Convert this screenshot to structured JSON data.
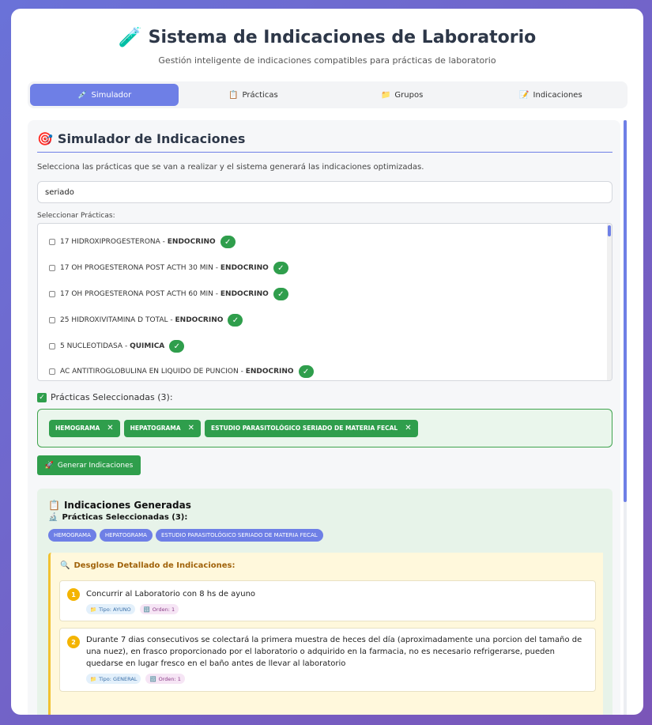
{
  "header": {
    "icon": "test-tube-icon",
    "title": "Sistema de Indicaciones de Laboratorio",
    "subtitle": "Gestión inteligente de indicaciones compatibles para prácticas de laboratorio"
  },
  "tabs": [
    {
      "label": "Simulador",
      "icon": "syringe-icon",
      "active": true
    },
    {
      "label": "Prácticas",
      "icon": "clipboard-icon",
      "active": false
    },
    {
      "label": "Grupos",
      "icon": "folder-icon",
      "active": false
    },
    {
      "label": "Indicaciones",
      "icon": "memo-icon",
      "active": false
    }
  ],
  "simulator": {
    "title": "Simulador de Indicaciones",
    "description": "Selecciona las prácticas que se van a realizar y el sistema generará las indicaciones optimizadas.",
    "search_value": "seriado",
    "select_label": "Seleccionar Prácticas:",
    "practices": [
      {
        "name": "17 HIDROXIPROGESTERONA",
        "sep": " - ",
        "area": "ENDOCRINO"
      },
      {
        "name": "17 OH PROGESTERONA POST ACTH 30 MIN",
        "sep": " - ",
        "area": "ENDOCRINO"
      },
      {
        "name": "17 OH PROGESTERONA POST ACTH 60 MIN",
        "sep": " - ",
        "area": "ENDOCRINO"
      },
      {
        "name": "25 HIDROXIVITAMINA D TOTAL",
        "sep": " - ",
        "area": "ENDOCRINO"
      },
      {
        "name": "5 NUCLEOTIDASA",
        "sep": " - ",
        "area": "QUIMICA"
      },
      {
        "name": "AC ANTITIROGLOBULINA EN LIQUIDO DE PUNCION",
        "sep": " - ",
        "area": "ENDOCRINO"
      }
    ],
    "check_glyph": "✓",
    "selected_title": "Prácticas Seleccionadas (3):",
    "selected_chips": [
      "HEMOGRAMA",
      "HEPATOGRAMA",
      "ESTUDIO PARASITOLÓGICO SERIADO DE MATERIA FECAL"
    ],
    "remove_glyph": "✕",
    "generate_label": "Generar Indicaciones"
  },
  "generated": {
    "title": "Indicaciones Generadas",
    "selected_title": "Prácticas Seleccionadas (3):",
    "pills": [
      "HEMOGRAMA",
      "HEPATOGRAMA",
      "ESTUDIO PARASITOLÓGICO SERIADO DE MATERIA FECAL"
    ],
    "breakdown_title": "Desglose Detallado de Indicaciones:",
    "indications": [
      {
        "num": "1",
        "text": "Concurrir al Laboratorio con 8 hs de ayuno",
        "tipo": "Tipo: AYUNO",
        "orden": "Orden: 1"
      },
      {
        "num": "2",
        "text": "Durante 7 dias consecutivos se colectará la primera muestra de heces del día (aproximadamente una porcion del tamaño de una nuez), en frasco proporcionado por el laboratorio o adquirido en la farmacia, no es necesario refrigerarse, pueden quedarse en lugar fresco en el baño antes de llevar al laboratorio",
        "tipo": "Tipo: GENERAL",
        "orden": "Orden: 1"
      }
    ]
  },
  "colors": {
    "accent": "#6e7fe6",
    "success": "#2f9e4c",
    "warning": "#f4b400"
  }
}
